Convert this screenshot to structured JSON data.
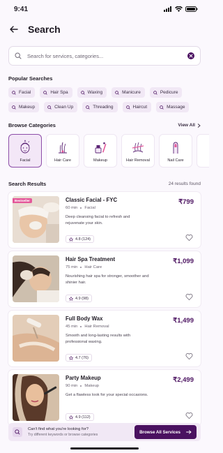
{
  "status_bar": {
    "time": "9:41"
  },
  "header": {
    "title": "Search"
  },
  "search": {
    "placeholder": "Search for services, categories..."
  },
  "popular": {
    "title": "Popular Searches",
    "chips": [
      "Facial",
      "Hair Spa",
      "Waxing",
      "Manicure",
      "Pedicure",
      "Makeup",
      "Clean Up",
      "Threading",
      "Haircut",
      "Massage"
    ]
  },
  "categories": {
    "title": "Browse Categories",
    "view_all": "View All",
    "items": [
      {
        "label": "Facial",
        "icon": "face-icon",
        "active": true
      },
      {
        "label": "Hair Care",
        "icon": "hair-follicle-icon"
      },
      {
        "label": "Makeup",
        "icon": "makeup-icon"
      },
      {
        "label": "Hair Removal",
        "icon": "hair-removal-icon"
      },
      {
        "label": "Nail Care",
        "icon": "nail-icon"
      },
      {
        "label": "N",
        "icon": "partial-icon"
      }
    ]
  },
  "results": {
    "title": "Search Results",
    "count_text": "24 results found",
    "items": [
      {
        "badge": "Bestseller",
        "name": "Classic Facial - FYC",
        "duration": "60 min",
        "category": "Facial",
        "description": "Deep cleansing facial to refresh and rejuvenate your skin.",
        "rating": "4.8 (124)",
        "price": "₹799"
      },
      {
        "name": "Hair Spa Treatment",
        "duration": "75 min",
        "category": "Hair Care",
        "description": "Nourishing hair spa for stronger, smoother and shinier hair.",
        "rating": "4.9 (98)",
        "price": "₹1,099"
      },
      {
        "name": "Full Body Wax",
        "duration": "45 min",
        "category": "Hair Removal",
        "description": "Smooth and long-lasting results with professional waxing.",
        "rating": "4.7 (76)",
        "price": "₹1,499"
      },
      {
        "name": "Party Makeup",
        "duration": "90 min",
        "category": "Makeup",
        "description": "Get a flawless look for your special occasions.",
        "rating": "4.9 (112)",
        "price": "₹2,499"
      }
    ]
  },
  "footer_banner": {
    "title": "Can't find what you're looking for?",
    "subtitle": "Try different keywords or browse categories",
    "button": "Browse All Services"
  },
  "colors": {
    "accent": "#4a1160",
    "chip_bg": "#f1e8f5",
    "badge": "#e4589a"
  }
}
